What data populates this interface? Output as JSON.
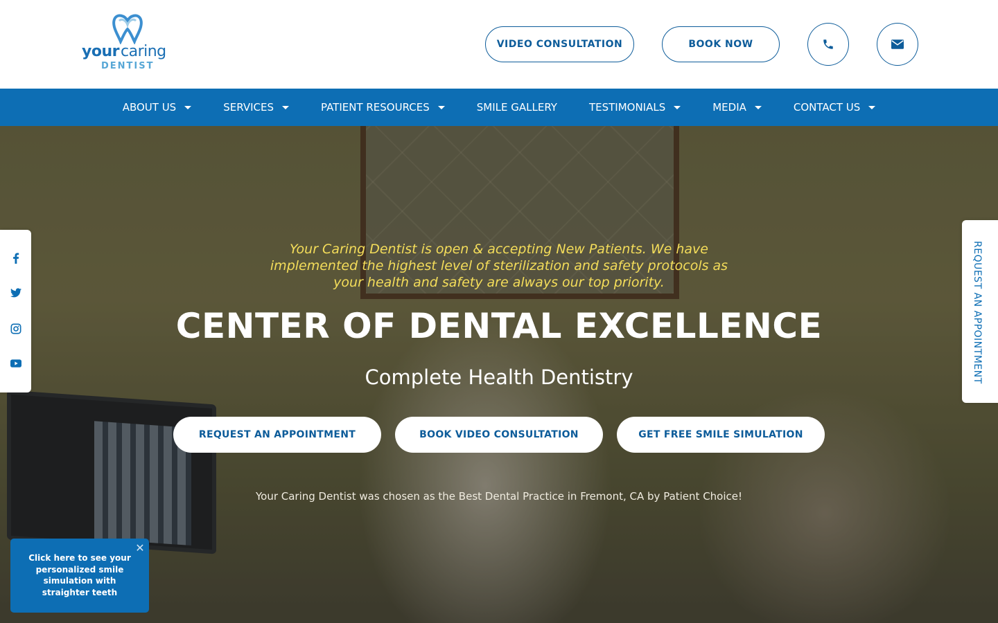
{
  "logo": {
    "word1": "your",
    "word2": "caring",
    "word3": "DENTIST"
  },
  "header": {
    "video_label": "VIDEO CONSULTATION",
    "book_label": "BOOK NOW",
    "phone_icon": "phone-icon",
    "mail_icon": "envelope-icon"
  },
  "nav": {
    "items": [
      {
        "label": "ABOUT US",
        "dropdown": true
      },
      {
        "label": "SERVICES",
        "dropdown": true
      },
      {
        "label": "PATIENT RESOURCES",
        "dropdown": true
      },
      {
        "label": "SMILE GALLERY",
        "dropdown": false
      },
      {
        "label": "TESTIMONIALS",
        "dropdown": true
      },
      {
        "label": "MEDIA",
        "dropdown": true
      },
      {
        "label": "CONTACT US",
        "dropdown": true
      }
    ]
  },
  "hero": {
    "notice": "Your Caring Dentist is open & accepting New Patients. We have implemented the highest level of sterilization and safety protocols as your health and safety are always our top priority.",
    "title": "CENTER OF DENTAL EXCELLENCE",
    "subtitle": "Complete Health Dentistry",
    "buttons": {
      "appointment": "REQUEST AN APPOINTMENT",
      "video": "BOOK VIDEO CONSULTATION",
      "simulation": "GET FREE SMILE SIMULATION"
    },
    "award": "Your Caring Dentist was chosen as the Best Dental Practice in Fremont, CA by Patient Choice!"
  },
  "social": {
    "icons": [
      "facebook-icon",
      "twitter-icon",
      "instagram-icon",
      "youtube-icon"
    ]
  },
  "request_tab": {
    "label": "REQUEST AN APPOINTMENT"
  },
  "smile_popup": {
    "text": "Click here to see your personalized smile simulation with straighter teeth",
    "close_glyph": "✕"
  },
  "colors": {
    "brand_blue": "#0d6eb4",
    "notice_yellow": "#f4dd5a"
  }
}
